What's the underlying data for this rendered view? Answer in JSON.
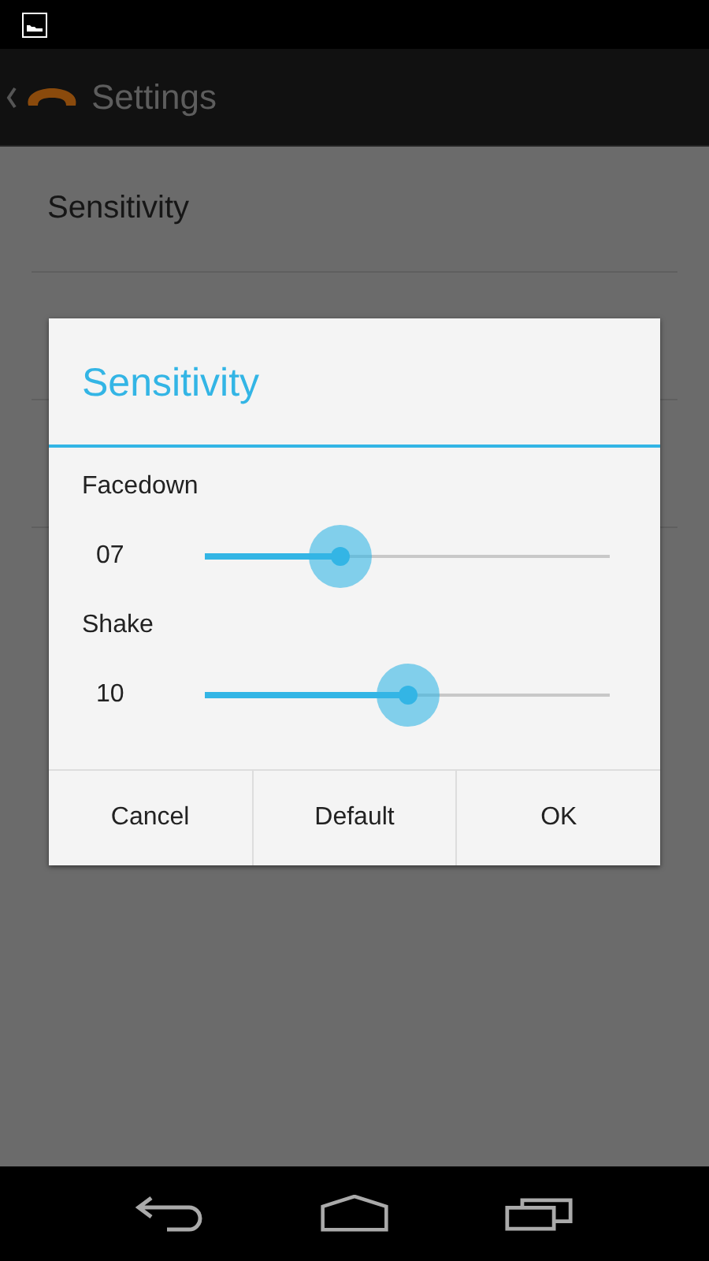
{
  "action_bar": {
    "title": "Settings"
  },
  "settings_list": [
    {
      "label": "Sensitivity"
    }
  ],
  "dialog": {
    "title": "Sensitivity",
    "sliders": [
      {
        "label": "Facedown",
        "reading": "07",
        "level": 0.335
      },
      {
        "label": "Shake",
        "reading": "10",
        "level": 0.5
      }
    ],
    "buttons": [
      "Cancel",
      "Default",
      "OK"
    ]
  }
}
